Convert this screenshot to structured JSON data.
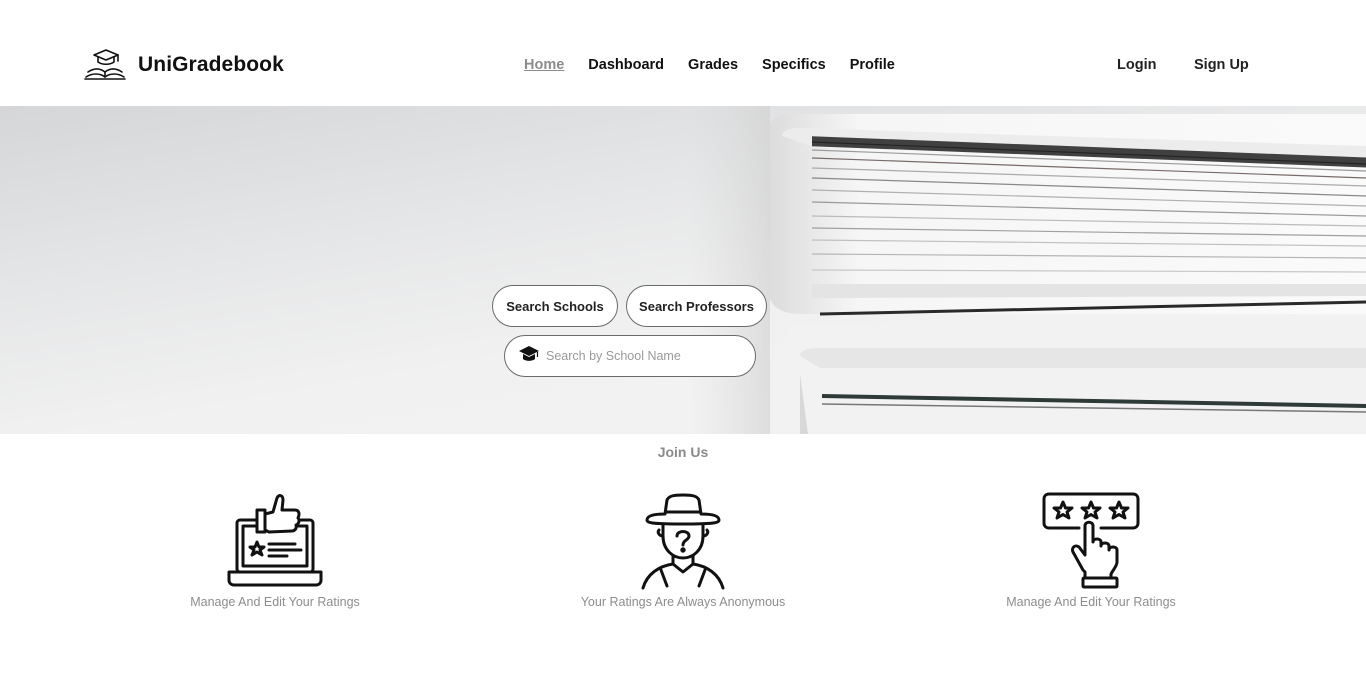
{
  "header": {
    "brand": "UniGradebook",
    "logo_icon": "graduation-cap-book-icon",
    "nav": [
      {
        "label": "Home",
        "active": true
      },
      {
        "label": "Dashboard",
        "active": false
      },
      {
        "label": "Grades",
        "active": false
      },
      {
        "label": "Specifics",
        "active": false
      },
      {
        "label": "Profile",
        "active": false
      }
    ],
    "login_label": "Login",
    "signup_label": "Sign Up"
  },
  "hero": {
    "search_schools_label": "Search Schools",
    "search_professors_label": "Search Professors",
    "search_icon": "graduation-cap-icon",
    "search_placeholder": "Search by School Name",
    "search_value": ""
  },
  "join": {
    "title": "Join Us",
    "features": [
      {
        "icon": "laptop-thumbs-up-icon",
        "caption": "Manage And Edit Your Ratings"
      },
      {
        "icon": "anonymous-person-icon",
        "caption": "Your Ratings Are Always Anonymous"
      },
      {
        "icon": "star-rating-hand-icon",
        "caption": "Manage And Edit Your Ratings"
      }
    ]
  },
  "colors": {
    "text": "#111111",
    "active_nav": "#8c8c8c",
    "caption": "#8d8d8d",
    "border": "#6a6a6a"
  }
}
